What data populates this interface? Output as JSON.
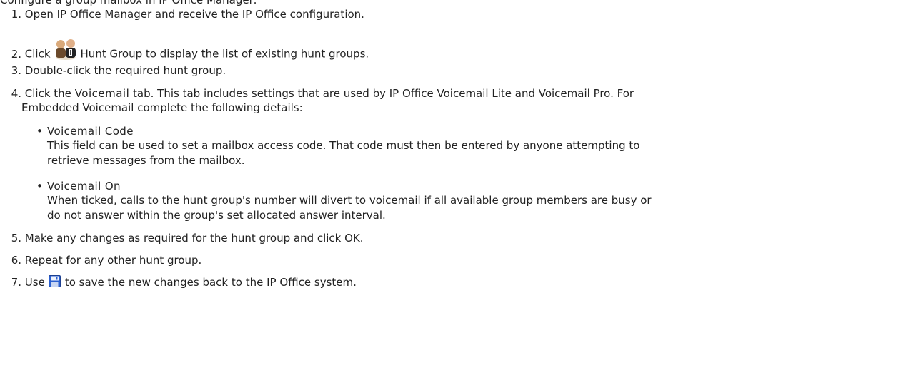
{
  "intro": "Configure a group mailbox in IP Office Manager:",
  "steps": [
    {
      "num": "1.",
      "text": "Open IP Office Manager and receive the IP Office configuration."
    },
    {
      "num": "2.",
      "pre": "Click",
      "icon": "hunt-group-icon",
      "post": "Hunt Group to display the list of existing hunt groups."
    },
    {
      "num": "3.",
      "text": "Double-click the required hunt group."
    },
    {
      "num": "4.",
      "pre": "Click the",
      "kw": "Voicemail",
      "post": "tab. This tab includes settings that are used by IP Office Voicemail Lite and Voicemail Pro. For",
      "line2": "Embedded Voicemail complete the following details:"
    },
    {
      "num": "5.",
      "text": "Make any changes as required for the hunt group and click OK."
    },
    {
      "num": "6.",
      "text": "Repeat for any other hunt group."
    },
    {
      "num": "7.",
      "pre": "Use",
      "icon": "save-icon",
      "post": "to save the new changes back to the IP Office system."
    }
  ],
  "bullets": [
    {
      "title": "Voicemail Code",
      "line1": "This field can be used to set a mailbox access code. That code must then be entered by anyone attempting to",
      "line2": "retrieve messages from the mailbox."
    },
    {
      "title": "Voicemail On",
      "line1": "When ticked, calls to the hunt group's number will divert to voicemail if all available group members are busy or",
      "line2": "do not answer within the group's set allocated answer interval."
    }
  ],
  "bullet_char": "•",
  "colors": {
    "text": "#222222",
    "save_icon_blue": "#2a5fd0"
  }
}
